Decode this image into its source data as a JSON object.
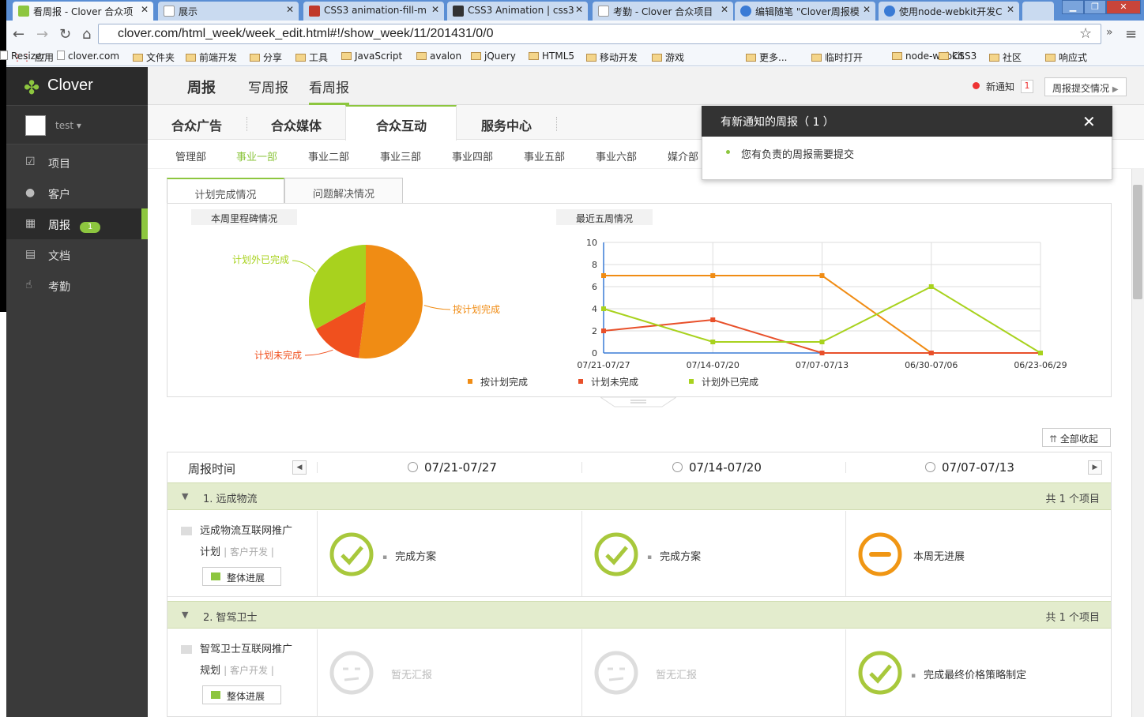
{
  "browser": {
    "tabs": [
      {
        "label": "看周报 - Clover 合众项",
        "color": "#8dc63f",
        "active": true
      },
      {
        "label": "展示",
        "color": "#ffffff",
        "active": false
      },
      {
        "label": "CSS3 animation-fill-m",
        "color": "#c0392b",
        "active": false
      },
      {
        "label": "CSS3 Animation | css3",
        "color": "#333333",
        "active": false
      },
      {
        "label": "考勤 - Clover 合众项目",
        "color": "#ffffff",
        "active": false
      },
      {
        "label": "编辑随笔 \"Clover周报模",
        "color": "#3a7bd5",
        "active": false
      },
      {
        "label": "使用node-webkit开发C",
        "color": "#3a7bd5",
        "active": false
      }
    ],
    "address": "clover.com/html_week/week_edit.html#!/show_week/11/201431/0/0",
    "apps_label": "应用",
    "bookmarks": [
      "clover.com",
      "文件夹",
      "前端开发",
      "分享",
      "工具",
      "JavaScript",
      "avalon",
      "jQuery",
      "HTML5",
      "移动开发",
      "游戏",
      "更多...",
      "临时打开",
      "node-webkit",
      "CSS3",
      "社区",
      "响应式",
      "Resizer"
    ]
  },
  "app": {
    "logo": "Clover",
    "user": "test",
    "sidebar": [
      {
        "label": "项目",
        "icon": "checkbox-icon"
      },
      {
        "label": "客户",
        "icon": "person-icon"
      },
      {
        "label": "周报",
        "icon": "calendar-icon",
        "badge": "1",
        "active": true
      },
      {
        "label": "文档",
        "icon": "document-icon"
      },
      {
        "label": "考勤",
        "icon": "hand-icon"
      }
    ],
    "topnav": [
      "周报",
      "写周报",
      "看周报"
    ],
    "notice_label": "新通知",
    "notice_count": "1",
    "submit_status": "周报提交情况",
    "secnav": [
      "合众广告",
      "合众媒体",
      "合众互动",
      "服务中心"
    ],
    "departments": [
      "管理部",
      "事业一部",
      "事业二部",
      "事业三部",
      "事业四部",
      "事业五部",
      "事业六部",
      "媒介部"
    ],
    "subtabs": [
      "计划完成情况",
      "问题解决情况"
    ],
    "pie_title": "本周里程碑情况",
    "line_title": "最近五周情况",
    "collapse_all": "全部收起",
    "table": {
      "header_label": "周报时间",
      "weeks": [
        "07/21-07/27",
        "07/14-07/20",
        "07/07-07/13"
      ],
      "groups": [
        {
          "name": "1. 远成物流",
          "count": "共 1 个项目",
          "project_line1": "远成物流互联网推广",
          "project_line2": "计划",
          "category": "| 客户开发 |",
          "button": "整体进展",
          "statuses": [
            {
              "type": "done",
              "text": "完成方案"
            },
            {
              "type": "done",
              "text": "完成方案"
            },
            {
              "type": "none",
              "text": "本周无进展"
            }
          ]
        },
        {
          "name": "2. 智驾卫士",
          "count": "共 1 个项目",
          "project_line1": "智驾卫士互联网推广",
          "project_line2": "规划",
          "category": "| 客户开发 |",
          "button": "整体进展",
          "statuses": [
            {
              "type": "empty",
              "text": "暂无汇报"
            },
            {
              "type": "empty",
              "text": "暂无汇报"
            },
            {
              "type": "done",
              "text": "完成最终价格策略制定"
            }
          ]
        }
      ]
    },
    "popup": {
      "title": "有新通知的周报（ 1 ）",
      "message": "您有负责的周报需要提交"
    }
  },
  "chart_data": [
    {
      "type": "pie",
      "title": "本周里程碑情况",
      "categories": [
        "按计划完成",
        "计划未完成",
        "计划外已完成"
      ],
      "values": [
        52,
        15,
        33
      ],
      "colors": [
        "#f08c14",
        "#f0501e",
        "#a8d21e"
      ]
    },
    {
      "type": "line",
      "title": "最近五周情况",
      "categories": [
        "07/21-07/27",
        "07/14-07/20",
        "07/07-07/13",
        "06/30-07/06",
        "06/23-06/29"
      ],
      "series": [
        {
          "name": "按计划完成",
          "values": [
            7,
            7,
            7,
            0,
            0
          ],
          "color": "#f08c14"
        },
        {
          "name": "计划未完成",
          "values": [
            2,
            3,
            0,
            0,
            0
          ],
          "color": "#e8502a"
        },
        {
          "name": "计划外已完成",
          "values": [
            4,
            1,
            1,
            6,
            0
          ],
          "color": "#a8d21e"
        }
      ],
      "ylim": [
        0,
        10
      ],
      "yticks": [
        0,
        2,
        4,
        6,
        8,
        10
      ],
      "grid": true,
      "legend": "bottom"
    }
  ]
}
